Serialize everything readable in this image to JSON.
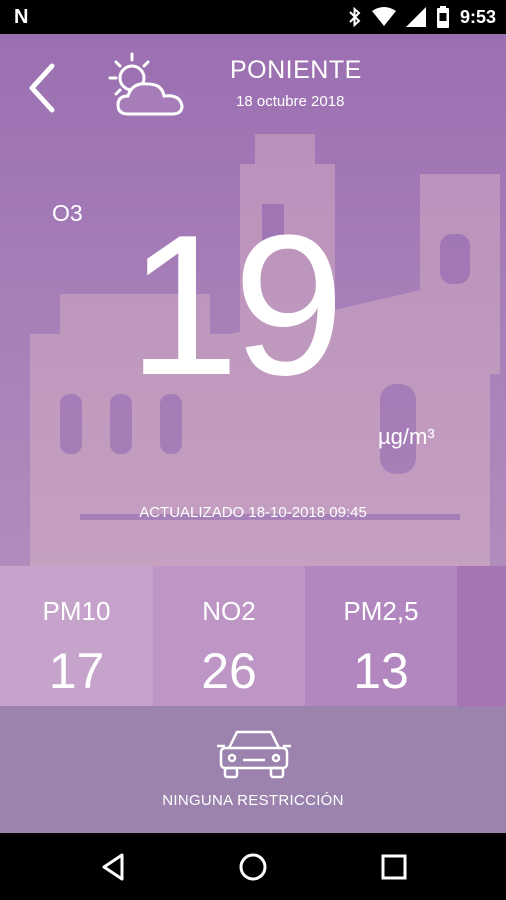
{
  "status_bar": {
    "left_glyph": "N",
    "time": "9:53",
    "icons": [
      "bluetooth-icon",
      "wifi-icon",
      "signal-icon",
      "battery-icon"
    ]
  },
  "header": {
    "station": "PONIENTE",
    "date": "18 octubre 2018",
    "weather_icon": "partly-cloudy-icon"
  },
  "reading": {
    "pollutant": "O3",
    "value": "19",
    "unit": "µg/m³",
    "updated": "ACTUALIZADO 18-10-2018 09:45"
  },
  "tiles": [
    {
      "name": "PM10",
      "value": "17",
      "color": "#c5a3cb"
    },
    {
      "name": "NO2",
      "value": "26",
      "color": "#bd96c6"
    },
    {
      "name": "PM2,5",
      "value": "13",
      "color": "#b286be"
    },
    {
      "name": "",
      "value": "",
      "color": "#a674b3"
    }
  ],
  "restriction": {
    "text": "NINGUNA RESTRICCIÓN",
    "icon": "car-icon"
  },
  "nav": [
    "back-nav-icon",
    "home-nav-icon",
    "recents-nav-icon"
  ]
}
